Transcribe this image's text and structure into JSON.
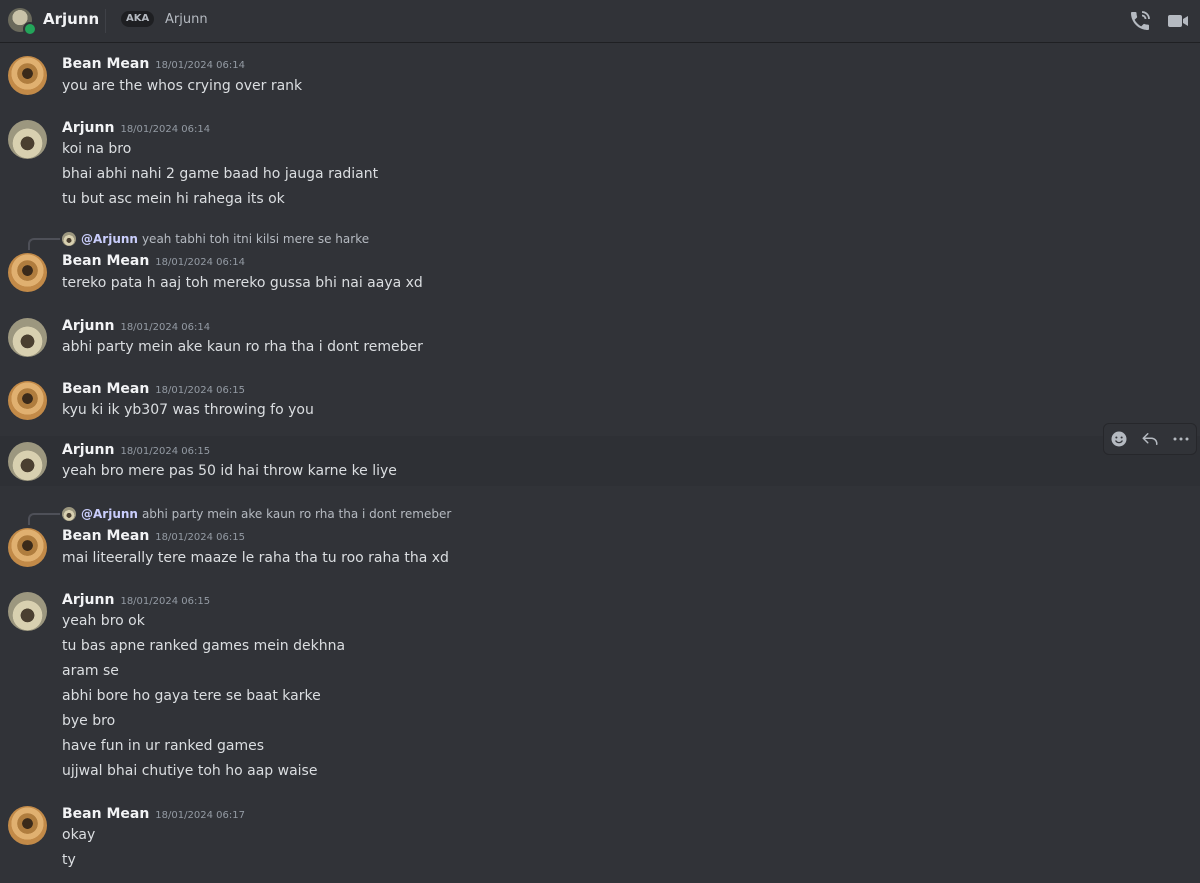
{
  "header": {
    "title": "Arjunn",
    "aka_badge": "AKA",
    "aka_name": "Arjunn",
    "icons": [
      "phone-call-icon",
      "video-camera-icon"
    ]
  },
  "messages": [
    {
      "author": "Bean Mean",
      "time": "18/01/2024 06:14",
      "lines": [
        "you are the whos crying over rank"
      ]
    },
    {
      "author": "Arjunn",
      "time": "18/01/2024 06:14",
      "lines": [
        "koi na bro",
        "bhai abhi nahi 2 game baad ho jauga radiant",
        "tu but asc mein hi rahega its ok"
      ]
    },
    {
      "reply": {
        "mention": "@Arjunn",
        "text": "yeah tabhi toh itni kilsi mere se harke"
      },
      "author": "Bean Mean",
      "time": "18/01/2024 06:14",
      "lines": [
        "tereko pata h aaj toh mereko gussa bhi nai aaya xd"
      ]
    },
    {
      "author": "Arjunn",
      "time": "18/01/2024 06:14",
      "lines": [
        "abhi party mein ake kaun ro rha tha i dont remeber"
      ]
    },
    {
      "author": "Bean Mean",
      "time": "18/01/2024 06:15",
      "lines": [
        "kyu ki ik yb307 was throwing fo you"
      ]
    },
    {
      "author": "Arjunn",
      "time": "18/01/2024 06:15",
      "lines": [
        "yeah bro mere pas 50 id hai throw karne ke liye"
      ]
    },
    {
      "reply": {
        "mention": "@Arjunn",
        "text": "abhi party mein ake kaun ro rha tha i dont remeber"
      },
      "author": "Bean Mean",
      "time": "18/01/2024 06:15",
      "lines": [
        "mai liteerally tere maaze le raha tha tu roo raha tha xd"
      ]
    },
    {
      "author": "Arjunn",
      "time": "18/01/2024 06:15",
      "lines": [
        "yeah bro ok",
        "tu bas apne ranked games mein dekhna",
        "aram se",
        "abhi bore ho gaya tere se baat karke",
        "bye bro",
        "have fun in ur ranked games",
        "ujjwal bhai chutiye toh ho aap waise"
      ]
    },
    {
      "author": "Bean Mean",
      "time": "18/01/2024 06:17",
      "lines": [
        "okay",
        "ty"
      ]
    }
  ],
  "toolbar": {
    "icons": [
      "add-reaction-icon",
      "reply-icon",
      "more-options-icon"
    ]
  }
}
